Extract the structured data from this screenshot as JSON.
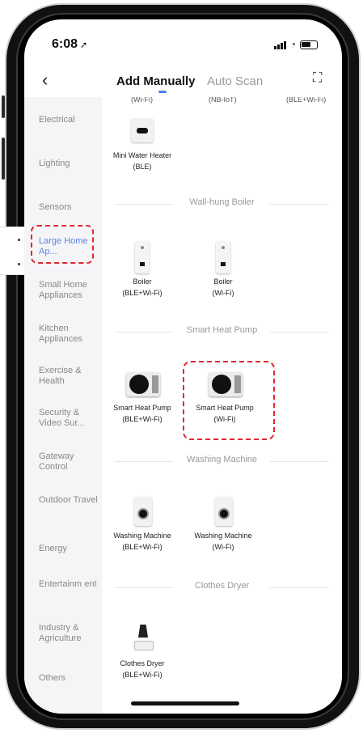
{
  "status_bar": {
    "time": "6:08",
    "location_arrow": "location-arrow-icon"
  },
  "header": {
    "back_glyph": "‹",
    "tab_manual": "Add Manually",
    "tab_auto": "Auto Scan",
    "scan_glyph": "⛶"
  },
  "sidebar": {
    "items": [
      {
        "label": "Electrical"
      },
      {
        "label": "Lighting"
      },
      {
        "label": "Sensors"
      },
      {
        "label": "Large Home Ap...",
        "active": true
      },
      {
        "label": "Small Home Appliances"
      },
      {
        "label": "Kitchen Appliances"
      },
      {
        "label": "Exercise & Health"
      },
      {
        "label": "Security & Video Sur..."
      },
      {
        "label": "Gateway Control"
      },
      {
        "label": "Outdoor Travel"
      },
      {
        "label": "Energy"
      },
      {
        "label": "Entertainm ent"
      },
      {
        "label": "Industry & Agriculture"
      },
      {
        "label": "Others"
      }
    ]
  },
  "content": {
    "cut_top": [
      "(Wi-Fi)",
      "(NB-IoT)",
      "(BLE+Wi-Fi)"
    ],
    "mini_heater": {
      "name": "Mini Water Heater",
      "proto": "(BLE)"
    },
    "sections": {
      "boiler": "Wall-hung Boiler",
      "pump": "Smart Heat Pump",
      "washer": "Washing Machine",
      "dryer": "Clothes Dryer"
    },
    "boilers": [
      {
        "name": "Boiler",
        "proto": "(BLE+Wi-Fi)"
      },
      {
        "name": "Boiler",
        "proto": "(Wi-Fi)"
      }
    ],
    "pumps": [
      {
        "name": "Smart Heat Pump",
        "proto": "(BLE+Wi-Fi)"
      },
      {
        "name": "Smart Heat Pump",
        "proto": "(Wi-Fi)"
      }
    ],
    "washers": [
      {
        "name": "Washing Machine",
        "proto": "(BLE+Wi-Fi)"
      },
      {
        "name": "Washing Machine",
        "proto": "(Wi-Fi)"
      }
    ],
    "dryers": [
      {
        "name": "Clothes Dryer",
        "proto": "(BLE+Wi-Fi)"
      }
    ]
  },
  "colors": {
    "accent": "#5b84e8",
    "highlight": "#e0282e"
  }
}
